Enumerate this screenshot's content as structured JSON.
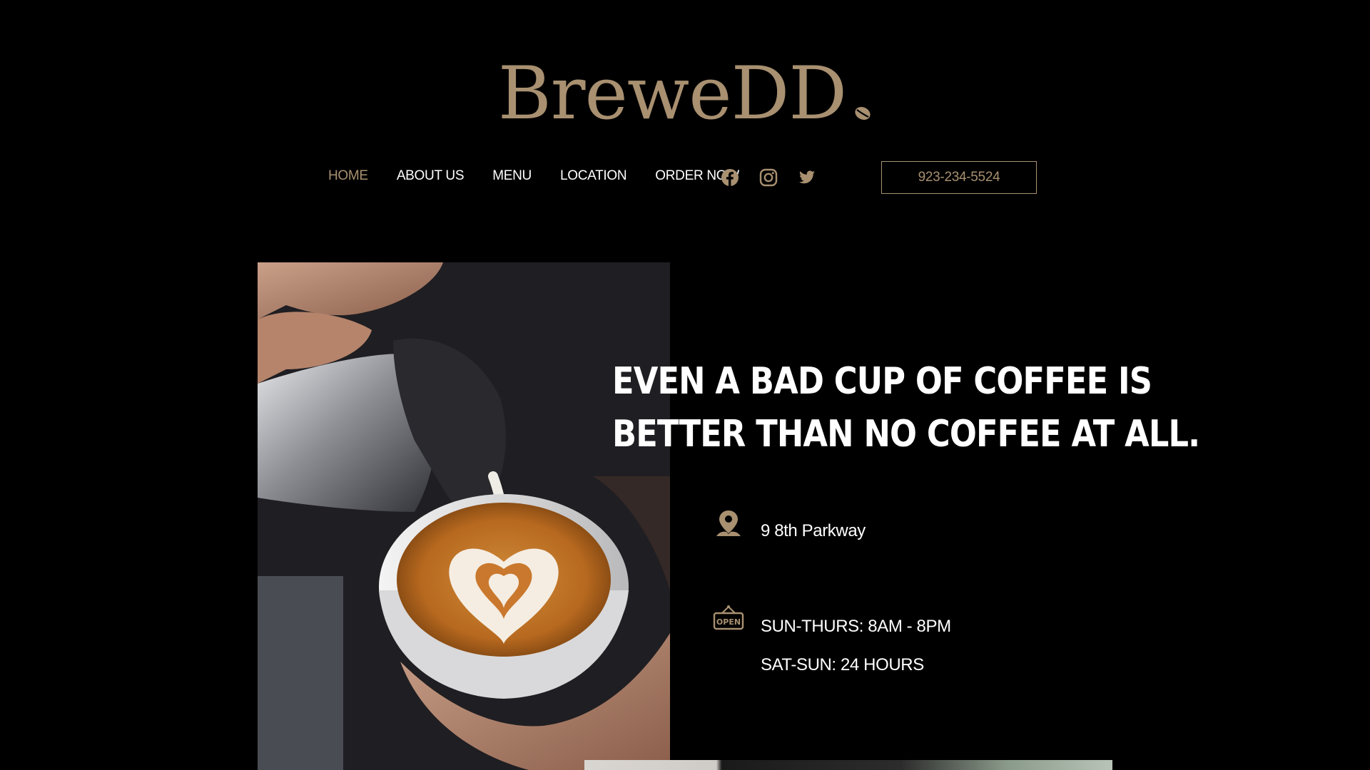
{
  "header": {
    "logo_text": "BreweDD",
    "nav": [
      {
        "label": "HOME",
        "active": true
      },
      {
        "label": "ABOUT US",
        "active": false
      },
      {
        "label": "MENU",
        "active": false
      },
      {
        "label": "LOCATION",
        "active": false
      },
      {
        "label": "ORDER NOW",
        "active": false
      }
    ],
    "social": [
      "facebook-icon",
      "instagram-icon",
      "twitter-icon"
    ],
    "phone_button": "923-234-5524"
  },
  "hero": {
    "headline_line1": "EVEN A BAD CUP OF COFFEE IS",
    "headline_line2": "BETTER THAN NO COFFEE AT ALL.",
    "address": "9 8th Parkway",
    "hours_weekday": "SUN-THURS: 8AM - 8PM",
    "hours_weekend": "SAT-SUN: 24 HOURS",
    "address_icon": "location-pin-icon",
    "hours_icon": "open-sign-icon"
  },
  "colors": {
    "accent": "#a89070",
    "background": "#000000",
    "text": "#ffffff"
  }
}
